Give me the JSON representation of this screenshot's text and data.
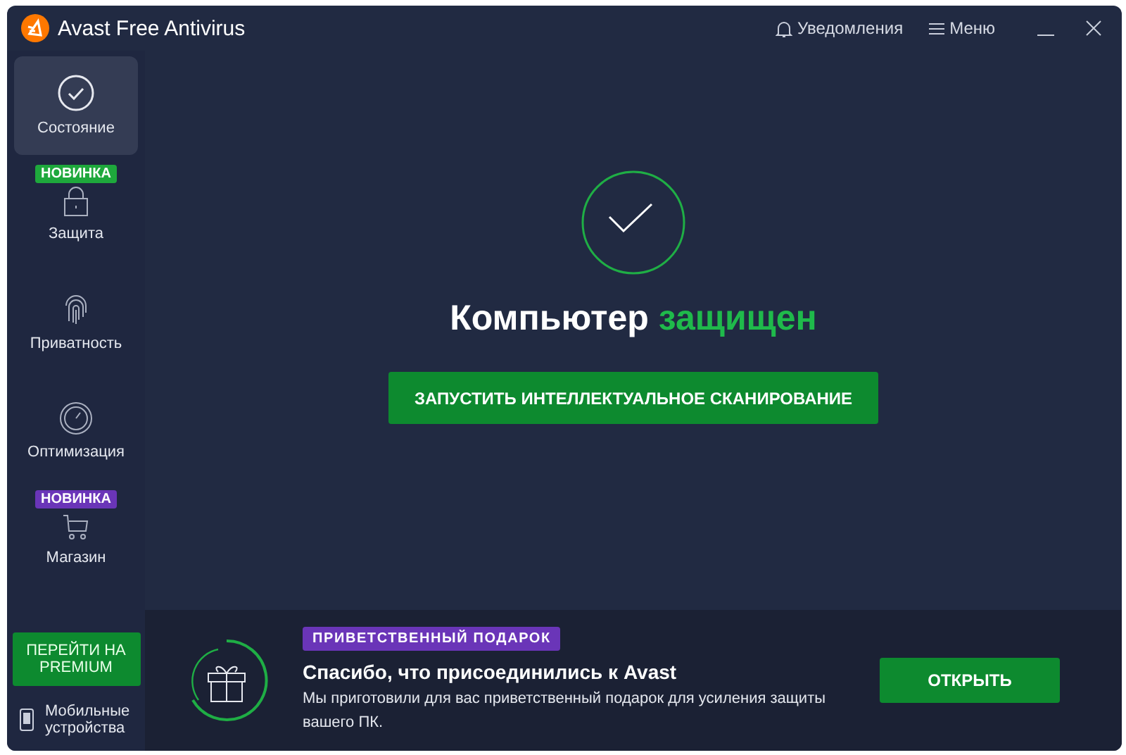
{
  "window": {
    "title": "Avast Free Antivirus"
  },
  "header_actions": [
    {
      "kind": "bell",
      "label": "Уведомления"
    },
    {
      "kind": "menu",
      "label": "Меню"
    }
  ],
  "sidebar": {
    "items": [
      {
        "kind": "check",
        "label": "Состояние",
        "selected": true
      },
      {
        "kind": "lock",
        "label": "Защита",
        "selected": false,
        "badge": {
          "text": "НОВИНКА",
          "color": "#1ea83c"
        }
      },
      {
        "kind": "fingerprint",
        "label": "Приватность",
        "selected": false
      },
      {
        "kind": "gauge",
        "label": "Оптимизация",
        "selected": false
      },
      {
        "kind": "cart",
        "label": "Магазин",
        "selected": false,
        "badge": {
          "text": "НОВИНКА",
          "color": "#6a35b8"
        }
      }
    ],
    "premium_button": "ПЕРЕЙТИ НА PREMIUM",
    "mobile_link": "Мобильные устройства"
  },
  "status": {
    "headline": "Компьютер",
    "state": "защищен",
    "scan_button": "ЗАПУСТИТЬ ИНТЕЛЛЕКТУАЛЬНОЕ СКАНИРОВАНИЕ"
  },
  "banner": {
    "tag": "ПРИВЕТСТВЕННЫЙ ПОДАРОК",
    "title": "Спасибо, что присоединились к Avast",
    "text": "Мы приготовили для вас приветственный подарок для усиления защиты вашего ПК.",
    "button": "ОТКРЫТЬ"
  }
}
